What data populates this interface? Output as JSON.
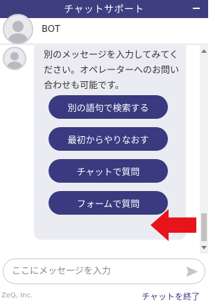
{
  "header": {
    "title": "チャットサポート"
  },
  "bot": {
    "name": "BOT"
  },
  "message": {
    "text": "別のメッセージを入力してみてください。オペレーターへのお問い合わせも可能です。",
    "choices": [
      "別の語句で検索する",
      "最初からやりなおす",
      "チャットで質問",
      "フォームで質問"
    ]
  },
  "annotation": {
    "arrow_color": "#e8141c",
    "points_to": "チャットで質問"
  },
  "input": {
    "placeholder": "ここにメッセージを入力",
    "value": ""
  },
  "footer": {
    "brand": "ZeQ, Inc.",
    "end_chat_label": "チャットを終了"
  },
  "colors": {
    "header": "#3d3d80",
    "button": "#3a3a80",
    "bubble": "#ebebf2"
  }
}
